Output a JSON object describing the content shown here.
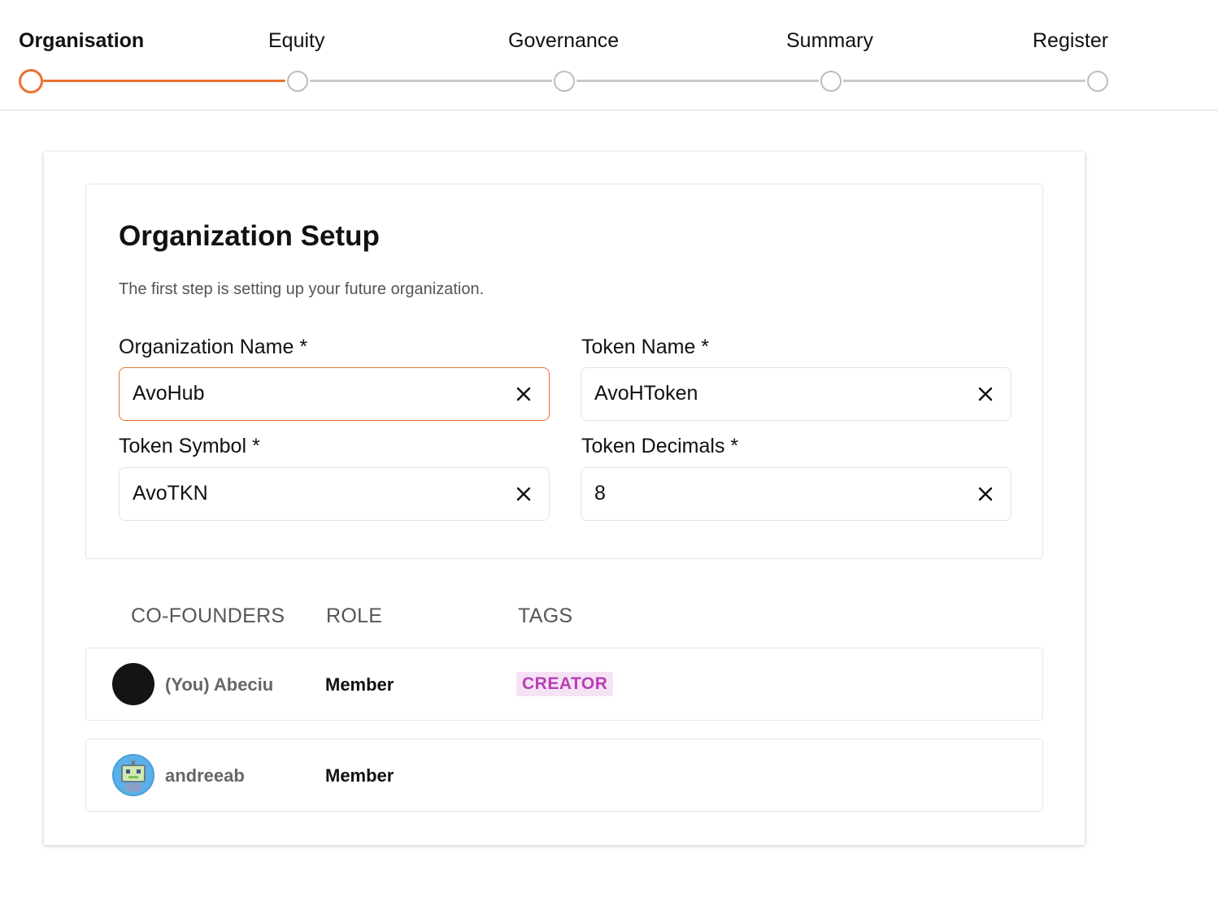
{
  "stepper": {
    "steps": [
      {
        "label": "Organisation",
        "active": true
      },
      {
        "label": "Equity",
        "active": false
      },
      {
        "label": "Governance",
        "active": false
      },
      {
        "label": "Summary",
        "active": false
      },
      {
        "label": "Register",
        "active": false
      }
    ],
    "accent_color": "#e8722f"
  },
  "setup": {
    "title": "Organization Setup",
    "description": "The first step is setting up your future organization.",
    "fields": {
      "org_name": {
        "label": "Organization Name *",
        "value": "AvoHub"
      },
      "token_name": {
        "label": "Token Name *",
        "value": "AvoHToken"
      },
      "token_symbol": {
        "label": "Token Symbol *",
        "value": "AvoTKN"
      },
      "token_decimals": {
        "label": "Token Decimals *",
        "value": "8"
      }
    },
    "clear_icon": "close-icon"
  },
  "cofounders": {
    "headers": {
      "name": "CO-FOUNDERS",
      "role": "ROLE",
      "tags": "TAGS"
    },
    "rows": [
      {
        "name": "(You) Abeciu",
        "role": "Member",
        "tag": "CREATOR",
        "avatar": "dark-circle-avatar"
      },
      {
        "name": "andreeab",
        "role": "Member",
        "tag": "",
        "avatar": "robot-avatar"
      }
    ],
    "tag_color": "#b63fb5"
  }
}
